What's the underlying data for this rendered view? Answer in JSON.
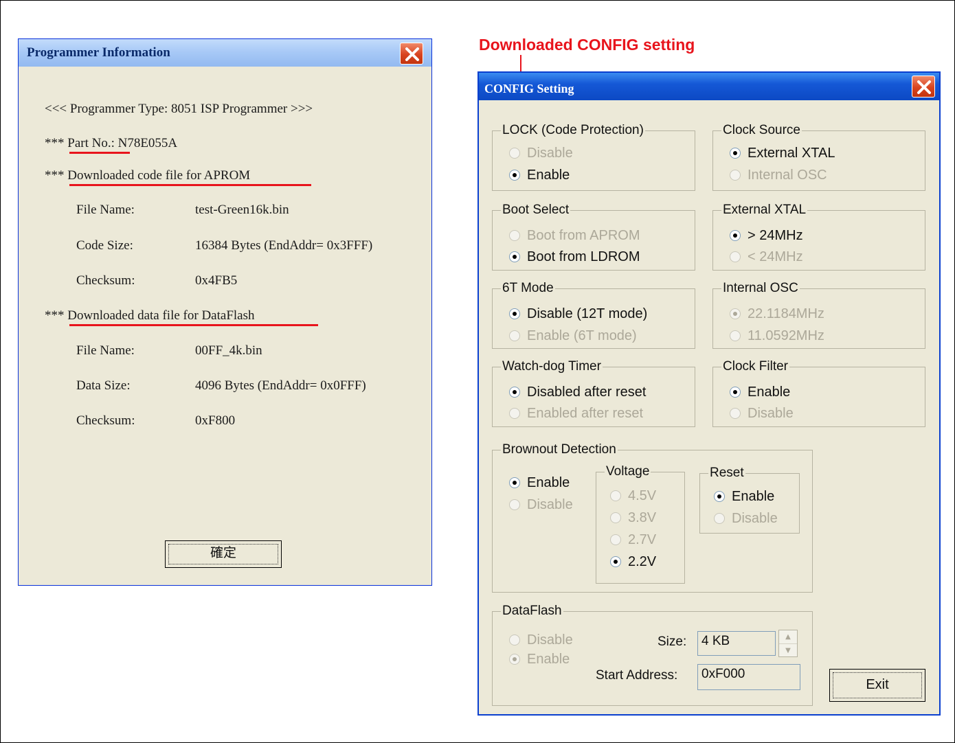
{
  "annotation": {
    "text": "Downloaded CONFIG setting",
    "color": "#e8141c"
  },
  "programmer_dialog": {
    "title": "Programmer Information",
    "type_line": "<<< Programmer Type: 8051 ISP Programmer >>>",
    "part_prefix": "***",
    "part_label": "Part No.",
    "part_value": ": N78E055A",
    "aprom_prefix": "***",
    "aprom_heading": "Downloaded code file for APROM",
    "aprom": {
      "file_name_label": "File Name:",
      "file_name": "test-Green16k.bin",
      "code_size_label": "Code Size:",
      "code_size": "16384 Bytes (EndAddr= 0x3FFF)",
      "checksum_label": "Checksum:",
      "checksum": "0x4FB5"
    },
    "dataflash_prefix": "***",
    "dataflash_heading": "Downloaded data file for DataFlash",
    "dataflash": {
      "file_name_label": "File Name:",
      "file_name": "00FF_4k.bin",
      "data_size_label": "Data Size:",
      "data_size": "4096 Bytes (EndAddr= 0x0FFF)",
      "checksum_label": "Checksum:",
      "checksum": "0xF800"
    },
    "ok_label": "確定"
  },
  "config_dialog": {
    "title": "CONFIG Setting",
    "lock": {
      "title": "LOCK (Code Protection)",
      "options": [
        "Disable",
        "Enable"
      ],
      "selected": "Enable"
    },
    "clock_source": {
      "title": "Clock Source",
      "options": [
        "External XTAL",
        "Internal OSC"
      ],
      "selected": "External XTAL"
    },
    "boot_select": {
      "title": "Boot Select",
      "options": [
        "Boot from APROM",
        "Boot from LDROM"
      ],
      "selected": "Boot from LDROM"
    },
    "external_xtal": {
      "title": "External XTAL",
      "options": [
        "> 24MHz",
        "< 24MHz"
      ],
      "selected": "> 24MHz"
    },
    "six_t_mode": {
      "title": "6T Mode",
      "options": [
        "Disable (12T mode)",
        "Enable (6T mode)"
      ],
      "selected": "Disable (12T mode)"
    },
    "internal_osc": {
      "title": "Internal OSC",
      "options": [
        "22.1184MHz",
        "11.0592MHz"
      ],
      "selected": "22.1184MHz"
    },
    "watchdog": {
      "title": "Watch-dog Timer",
      "options": [
        "Disabled after reset",
        "Enabled after reset"
      ],
      "selected": "Disabled after reset"
    },
    "clock_filter": {
      "title": "Clock Filter",
      "options": [
        "Enable",
        "Disable"
      ],
      "selected": "Enable"
    },
    "brownout": {
      "title": "Brownout Detection",
      "options": [
        "Enable",
        "Disable"
      ],
      "selected": "Enable",
      "voltage": {
        "title": "Voltage",
        "options": [
          "4.5V",
          "3.8V",
          "2.7V",
          "2.2V"
        ],
        "selected": "2.2V"
      },
      "reset": {
        "title": "Reset",
        "options": [
          "Enable",
          "Disable"
        ],
        "selected": "Enable"
      }
    },
    "dataflash": {
      "title": "DataFlash",
      "options": [
        "Disable",
        "Enable"
      ],
      "selected": "Enable",
      "size_label": "Size:",
      "size_value": "4 KB",
      "start_label": "Start Address:",
      "start_value": "0xF000"
    },
    "exit_label": "Exit"
  }
}
